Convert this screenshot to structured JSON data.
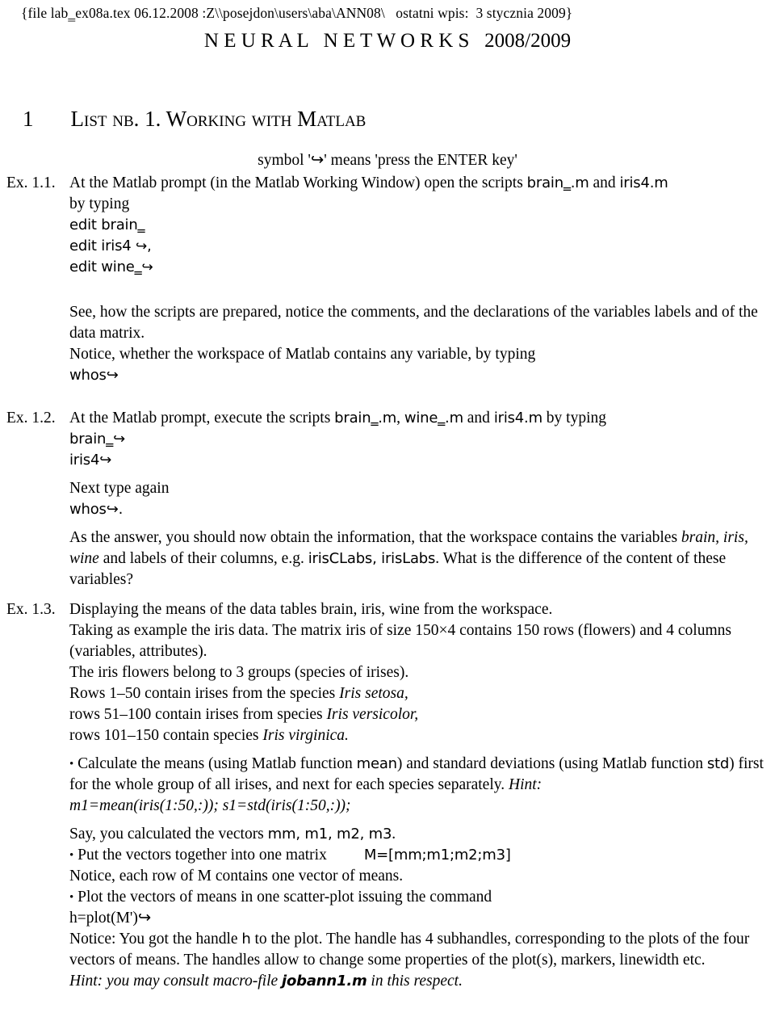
{
  "header": {
    "file_line": "{file lab‗ex08a.tex 06.12.2008 :Z\\\\posejdon\\users\\aba\\ANN08\\   ostatni wpis:  3 stycznia 2009}"
  },
  "title": {
    "main": "N E U R A L   N E T W O R K S   2008/2009"
  },
  "section": {
    "number": "1",
    "title_a": "List nb. 1. Working with Matlab"
  },
  "note": {
    "text": "symbol '↪' means 'press the ENTER key'"
  },
  "exercises": [
    {
      "label": "Ex. 1.1.",
      "lines": [
        "At the Matlab prompt (in the Matlab Working Window) open the scripts ",
        "brain‗.m",
        " and ",
        "iris4.m",
        "by typing",
        "edit brain‗",
        "edit iris4 ↪,",
        "edit wine‗↪",
        "See, how the scripts are prepared, notice the comments, and the declarations of the variables labels and of the data matrix.",
        "Notice, whether the workspace of Matlab contains any variable, by typing",
        "whos↪"
      ]
    },
    {
      "label": "Ex. 1.2.",
      "lines": [
        "At the Matlab prompt, execute the scripts ",
        "brain‗.m",
        "wine‗.m",
        "iris4.m",
        " by typing",
        "brain‗↪",
        "iris4↪",
        "Next type again",
        "whos↪.",
        "As the answer, you should now obtain the information, that the workspace contains the variables ",
        "brain, iris, wine",
        " and labels of their columns, e.g. ",
        "irisCLabs, irisLabs",
        ". What is the difference of the content of these variables?"
      ]
    },
    {
      "label": "Ex. 1.3.",
      "lines": [
        "Displaying the means of the data tables brain, iris, wine from the workspace.",
        "Taking as example the iris data. The matrix iris of size 150×4 contains 150 rows (flowers) and 4 columns (variables, attributes).",
        "The iris flowers belong to 3 groups (species of irises).",
        "Rows 1–50 contain irises from the species ",
        "Iris setosa,",
        "rows 51–100 contain irises from species ",
        "Iris versicolor,",
        "rows 101–150 contain species ",
        "Iris virginica.",
        "• Calculate the means (using Matlab function ",
        "mean",
        ") and standard deviations (using Matlab function ",
        "std",
        ") first for the whole group of all irises, and next for each species separately. ",
        "Hint:",
        "m1=mean(iris(1:50,:)); s1=std(iris(1:50,:));",
        "Say, you calculated the vectors ",
        "mm, m1, m2, m3",
        ".",
        "• Put the vectors together into one matrix",
        "M=[mm;m1;m2;m3]",
        "Notice, each row of M contains one vector of means.",
        "• Plot the vectors of means in one scatter-plot issuing the command",
        "h=plot(M')↪",
        "Notice: You got the handle ",
        "h",
        " to the plot. The handle has 4 subhandles, corresponding to the plots of the four vectors of means. The handles allow to change some properties of the plot(s), markers, linewidth etc.",
        "Hint: you may consult macro-file ",
        "jobann1.m",
        " in this respect."
      ]
    }
  ],
  "text": {
    "ex11_intro_a": "At the Matlab prompt (in the Matlab Working Window) open the scripts ",
    "ex11_script1": "brain‗.m",
    "ex11_and": " and ",
    "ex11_script2": "iris4.m",
    "ex11_by_typing": "by typing",
    "ex11_cmd1": "edit brain‗",
    "ex11_cmd2a": "edit iris4 ",
    "ex11_cmd2b": "↪,",
    "ex11_cmd3a": "edit wine‗",
    "ex11_cmd3b": "↪",
    "ex11_para1": "See, how the scripts are prepared, notice the comments, and the declarations of the variables labels and of the data matrix.",
    "ex11_para2": "Notice, whether the workspace of Matlab contains any variable, by typing",
    "ex11_whos": "whos↪",
    "ex12_intro_a": "At the Matlab prompt, execute the scripts ",
    "ex12_s1": "brain‗.m",
    "ex12_c1": ", ",
    "ex12_s2": "wine‗.m",
    "ex12_c2": " and ",
    "ex12_s3": "iris4.m",
    "ex12_tail": " by typing",
    "ex12_cmd1": "brain‗↪",
    "ex12_cmd2": "iris4↪",
    "ex12_next": "Next type again",
    "ex12_whos": "whos↪.",
    "ex12_ans_a": "As the answer, you should now obtain the information, that the workspace contains the variables ",
    "ex12_ans_it": "brain, iris, wine",
    "ex12_ans_b": " and labels of their columns, e.g. ",
    "ex12_ans_tt": "irisCLabs, irisLabs",
    "ex12_ans_c": ". What is the difference of the content of these variables?",
    "ex13_l1": "Displaying the means of the data tables brain, iris, wine from the workspace.",
    "ex13_l2": "Taking as example the iris data. The matrix iris of size 150×4 contains 150 rows (flowers) and 4 columns (variables, attributes).",
    "ex13_l3": "The iris flowers belong to 3 groups (species of irises).",
    "ex13_l4a": "Rows 1–50 contain irises from the species ",
    "ex13_l4b": "Iris setosa,",
    "ex13_l5a": "rows 51–100 contain irises from species ",
    "ex13_l5b": "Iris versicolor,",
    "ex13_l6a": "rows 101–150 contain species ",
    "ex13_l6b": "Iris virginica.",
    "ex13_b1_a": "Calculate the means (using Matlab function ",
    "ex13_b1_tt1": "mean",
    "ex13_b1_b": ") and standard deviations (using Matlab function ",
    "ex13_b1_tt2": "std",
    "ex13_b1_c": ") first for the whole group of all irises, and next for each species separately. ",
    "ex13_b1_hint": "Hint:",
    "ex13_code1": "m1=mean(iris(1:50,:)); s1=std(iris(1:50,:));",
    "ex13_say_a": "Say, you calculated the vectors ",
    "ex13_say_tt": "mm, m1, m2, m3",
    "ex13_say_b": ".",
    "ex13_b2": "Put the vectors together into one matrix",
    "ex13_b2_code": "M=[mm;m1;m2;m3]",
    "ex13_notice_row": "Notice, each row of M contains one vector of means.",
    "ex13_b3": "Plot the vectors of means in one scatter-plot issuing the command",
    "ex13_code2": "h=plot(M')↪",
    "ex13_notice_a": "Notice: You got the handle ",
    "ex13_notice_tt": "h",
    "ex13_notice_b": " to the plot. The handle has 4 subhandles, corresponding to the plots of the four vectors of means. The handles allow to change some properties of the plot(s), markers, linewidth etc.",
    "ex13_hint_a": "Hint: you may consult macro-file ",
    "ex13_hint_tt": "jobann1.m",
    "ex13_hint_b": " in this respect.",
    "bullet": "•"
  },
  "colors": {
    "text": "#000000",
    "background": "#ffffff"
  }
}
